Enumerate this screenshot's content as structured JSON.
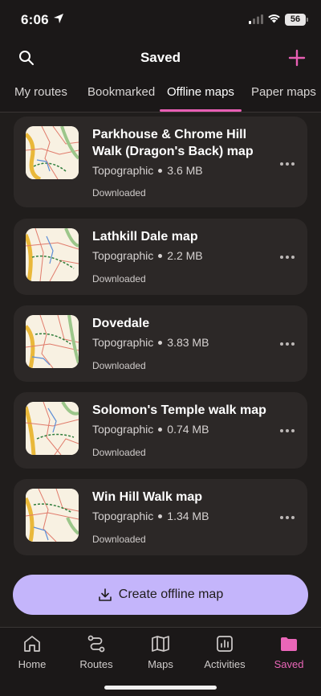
{
  "status_bar": {
    "time": "6:06",
    "battery": "56"
  },
  "header": {
    "title": "Saved"
  },
  "tabs": [
    {
      "label": "My routes"
    },
    {
      "label": "Bookmarked"
    },
    {
      "label": "Offline maps"
    },
    {
      "label": "Paper maps"
    }
  ],
  "active_tab": "Offline maps",
  "maps": [
    {
      "title": "Parkhouse & Chrome Hill Walk (Dragon's Back) map",
      "type": "Topographic",
      "size": "3.6 MB",
      "status": "Downloaded"
    },
    {
      "title": "Lathkill Dale map",
      "type": "Topographic",
      "size": "2.2 MB",
      "status": "Downloaded"
    },
    {
      "title": "Dovedale",
      "type": "Topographic",
      "size": "3.83 MB",
      "status": "Downloaded"
    },
    {
      "title": "Solomon's Temple walk map",
      "type": "Topographic",
      "size": "0.74 MB",
      "status": "Downloaded"
    },
    {
      "title": "Win Hill Walk map",
      "type": "Topographic",
      "size": "1.34 MB",
      "status": "Downloaded"
    }
  ],
  "cta": {
    "label": "Create offline map"
  },
  "bottom_nav": [
    {
      "label": "Home",
      "icon": "home-icon"
    },
    {
      "label": "Routes",
      "icon": "routes-icon"
    },
    {
      "label": "Maps",
      "icon": "map-icon"
    },
    {
      "label": "Activities",
      "icon": "activities-icon"
    },
    {
      "label": "Saved",
      "icon": "folder-icon"
    }
  ],
  "active_nav": "Saved",
  "colors": {
    "accent_pink": "#e85fb4",
    "cta_purple": "#c4b5fb",
    "card_bg": "#2c2827",
    "page_bg": "#201d1c"
  }
}
